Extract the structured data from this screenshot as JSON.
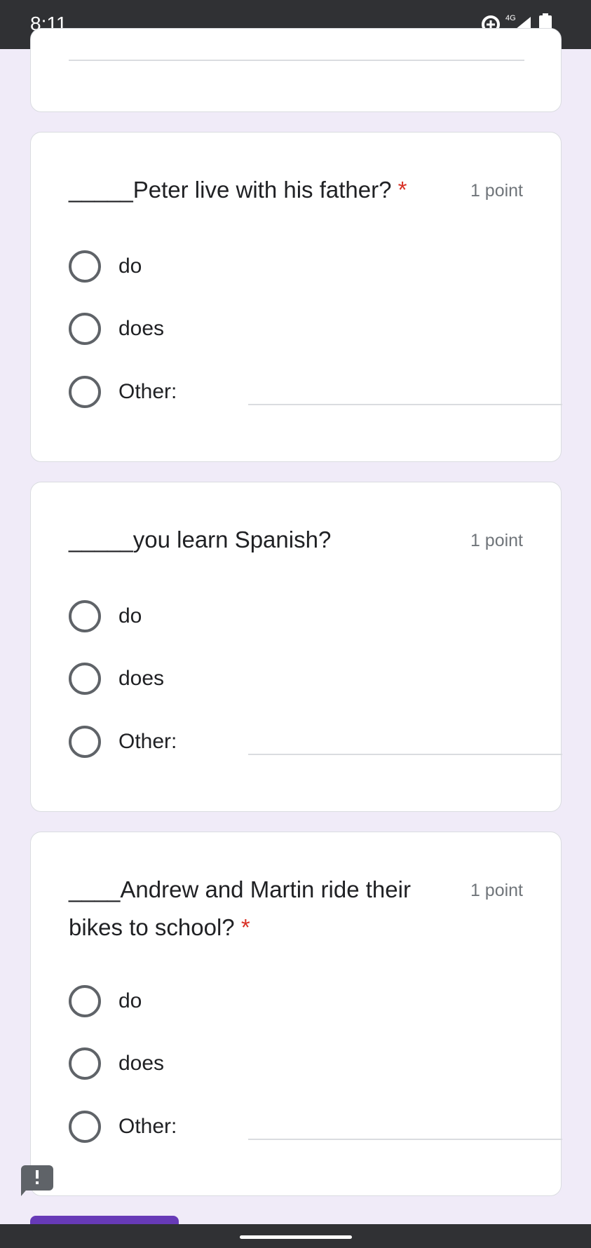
{
  "status_bar": {
    "time": "8:11",
    "network": "4G"
  },
  "questions": [
    {
      "title_line1": "_____Peter live with his father?",
      "title_line2": "",
      "required_mark": "*",
      "points": "1 point",
      "options": [
        "do",
        "does",
        "Other:"
      ]
    },
    {
      "title_line1": "_____you learn Spanish?",
      "title_line2": "",
      "required_mark": "",
      "points": "1 point",
      "options": [
        "do",
        "does",
        "Other:"
      ]
    },
    {
      "title_line1": "____Andrew and Martin ride their",
      "title_line2": "bikes to school?",
      "required_mark": "*",
      "points": "1 point",
      "options": [
        "do",
        "does",
        "Other:"
      ]
    }
  ],
  "colors": {
    "accent": "#673ab7",
    "background": "#f0ebf8",
    "required": "#d93025"
  }
}
